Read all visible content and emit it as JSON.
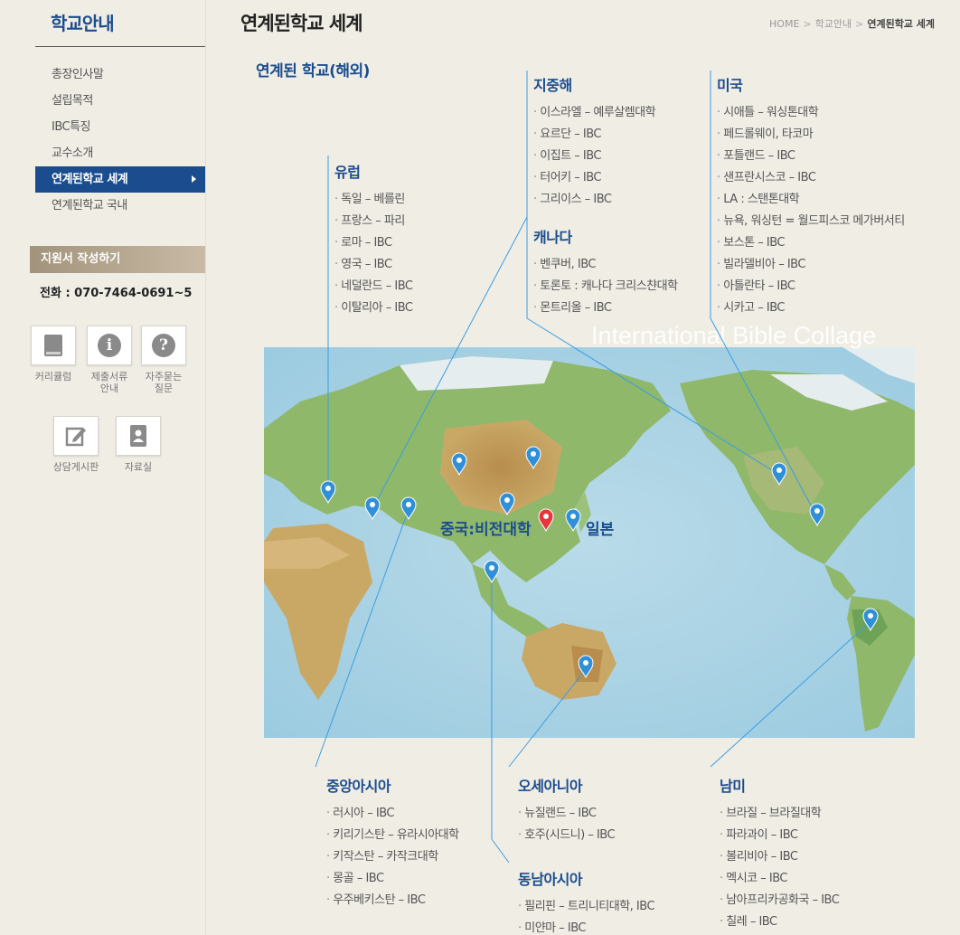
{
  "sidebar": {
    "title": "학교안내",
    "menu": [
      {
        "label": "총장인사말"
      },
      {
        "label": "설립목적"
      },
      {
        "label": "IBC특징"
      },
      {
        "label": "교수소개"
      },
      {
        "label": "연계된학교 세계",
        "active": true
      },
      {
        "label": "연계된학교 국내"
      }
    ],
    "apply_label": "지원서 작성하기",
    "phone": "전화 : 070-7464-0691~5",
    "quick_links": [
      {
        "icon": "book-icon",
        "label": "커리큘럼"
      },
      {
        "icon": "info-icon",
        "label": "제출서류\n안내"
      },
      {
        "icon": "question-icon",
        "label": "자주묻는\n질문"
      },
      {
        "icon": "edit-icon",
        "label": "상담게시판"
      },
      {
        "icon": "contact-book-icon",
        "label": "자료실"
      }
    ]
  },
  "header": {
    "title": "연계된학교 세계",
    "breadcrumb": [
      "HOME",
      "학교안내",
      "연계된학교 세계"
    ]
  },
  "content": {
    "heading": "연계된 학교(해외)",
    "map_caption": "International Bible Collage",
    "map_labels": {
      "china": "중국:비전대학",
      "japan": "일본"
    },
    "regions": {
      "europe": {
        "title": "유럽",
        "items": [
          "독일 – 베를린",
          "프랑스 – 파리",
          "로마 – IBC",
          "영국 – IBC",
          "네덜란드 – IBC",
          "이탈리아 – IBC"
        ]
      },
      "mediterranean": {
        "title": "지중해",
        "items": [
          "이스라엘 – 예루살렘대학",
          "요르단 – IBC",
          "이집트 – IBC",
          "터어키 – IBC",
          "그리이스 – IBC"
        ]
      },
      "canada": {
        "title": "캐나다",
        "items": [
          "벤쿠버, IBC",
          "토론토 : 캐나다 크리스챤대학",
          "몬트리올 – IBC"
        ]
      },
      "usa": {
        "title": "미국",
        "items": [
          "시애틀 – 워싱톤대학",
          "페드롤웨이, 타코마",
          "포틀랜드 – IBC",
          "샌프란시스코 – IBC",
          "LA : 스탠톤대학",
          "뉴욕, 워싱턴 = 월드피스코 메가버서티",
          "보스톤 – IBC",
          "빌라델비아 – IBC",
          "아틀란타 – IBC",
          "시카고 – IBC"
        ]
      },
      "central_asia": {
        "title": "중앙아시아",
        "items": [
          "러시아 – IBC",
          "키리기스탄 – 유라시아대학",
          "키작스탄 – 카작크대학",
          "몽골 – IBC",
          "우주베키스탄 – IBC"
        ]
      },
      "oceania": {
        "title": "오세아니아",
        "items": [
          "뉴질랜드 – IBC",
          "호주(시드니) – IBC"
        ]
      },
      "southeast_asia": {
        "title": "동남아시아",
        "items": [
          "필리핀 – 트리니티대학, IBC",
          "미얀마 – IBC"
        ]
      },
      "south_america": {
        "title": "남미",
        "items": [
          "브라질 – 브라질대학",
          "파라과이 – IBC",
          "볼리비아 – IBC",
          "멕시코 – IBC",
          "남아프리카공화국 – IBC",
          "칠레 – IBC"
        ]
      }
    }
  },
  "colors": {
    "brand": "#1b4d8e",
    "pin": "#2f8fd8",
    "pin_highlight": "#e8343b",
    "line": "#3a9de0"
  }
}
